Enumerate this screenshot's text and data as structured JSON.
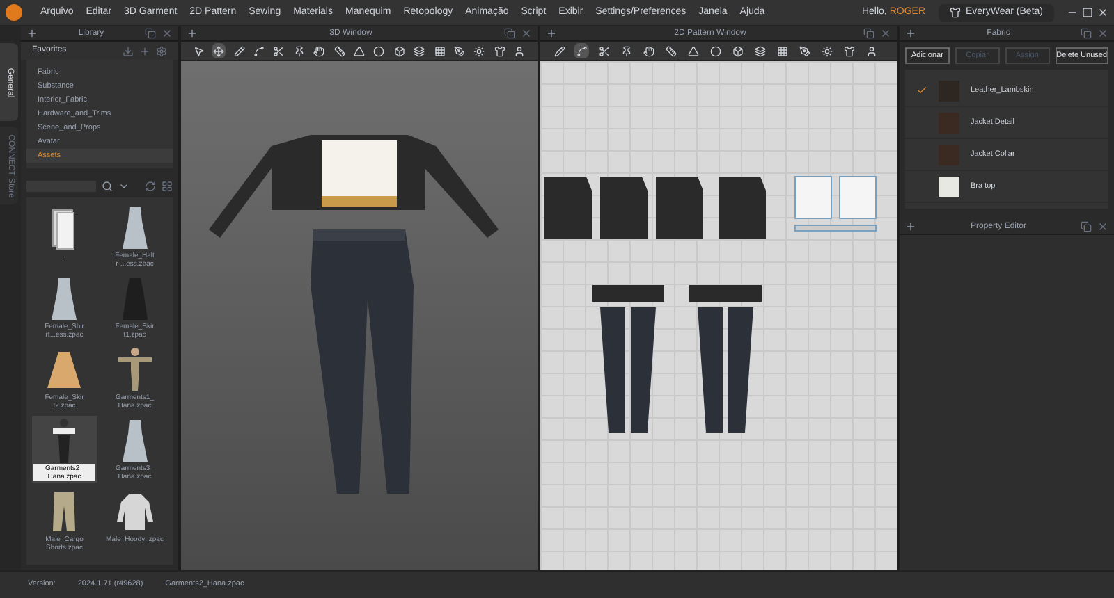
{
  "menu": [
    "Arquivo",
    "Editar",
    "3D Garment",
    "2D Pattern",
    "Sewing",
    "Materials",
    "Manequim",
    "Retopology",
    "Animação",
    "Script",
    "Exibir",
    "Settings/Preferences",
    "Janela",
    "Ajuda"
  ],
  "greeting": {
    "prefix": "Hello,",
    "user": "ROGER"
  },
  "app_button": "EveryWear (Beta)",
  "side_tabs": [
    {
      "label": "General",
      "selected": true
    },
    {
      "label": "CONNECT Store",
      "selected": false
    }
  ],
  "library": {
    "title": "Library",
    "favorites_title": "Favorites",
    "items": [
      {
        "label": "Fabric",
        "selected": false
      },
      {
        "label": "Substance",
        "selected": false
      },
      {
        "label": "Interior_Fabric",
        "selected": false
      },
      {
        "label": "Hardware_and_Trims",
        "selected": false
      },
      {
        "label": "Scene_and_Props",
        "selected": false
      },
      {
        "label": "Avatar",
        "selected": false
      },
      {
        "label": "Assets",
        "selected": true
      }
    ],
    "files": [
      {
        "label": ".",
        "kind": "folder",
        "selected": false
      },
      {
        "label": "Female_Halt r-...ess.zpac",
        "kind": "dress",
        "selected": false
      },
      {
        "label": "Female_Shir rt...ess.zpac",
        "kind": "dress",
        "selected": false
      },
      {
        "label": "Female_Skir t1.zpac",
        "kind": "dark",
        "selected": false
      },
      {
        "label": "Female_Skir t2.zpac",
        "kind": "skirt",
        "selected": false
      },
      {
        "label": "Garments1_ Hana.zpac",
        "kind": "avatar",
        "selected": false
      },
      {
        "label": "Garments2_ Hana.zpac",
        "kind": "outfit",
        "selected": true
      },
      {
        "label": "Garments3_ Hana.zpac",
        "kind": "dress",
        "selected": false
      },
      {
        "label": "Male_Cargo Shorts.zpac",
        "kind": "pants",
        "selected": false
      },
      {
        "label": "Male_Hoody .zpac",
        "kind": "hoodie",
        "selected": false
      }
    ]
  },
  "window_3d": {
    "title": "3D Window"
  },
  "window_2d": {
    "title": "2D Pattern Window"
  },
  "fabric": {
    "title": "Fabric",
    "buttons": [
      {
        "label": "Adicionar",
        "disabled": false
      },
      {
        "label": "Copiar",
        "disabled": true
      },
      {
        "label": "Assign",
        "disabled": true
      },
      {
        "label": "Delete Unused",
        "disabled": false
      }
    ],
    "items": [
      {
        "name": "Leather_Lambskin",
        "checked": true,
        "color": "#2e2620"
      },
      {
        "name": "Jacket Detail",
        "checked": false,
        "color": "#3a2a22"
      },
      {
        "name": "Jacket Collar",
        "checked": false,
        "color": "#3a2a22"
      },
      {
        "name": "Bra top",
        "checked": false,
        "color": "#e8e8e2"
      }
    ]
  },
  "property_editor": {
    "title": "Property Editor"
  },
  "status_bar": {
    "label": "Version:",
    "version": "2024.1.71 (r49628)",
    "file": "Garments2_Hana.zpac"
  }
}
